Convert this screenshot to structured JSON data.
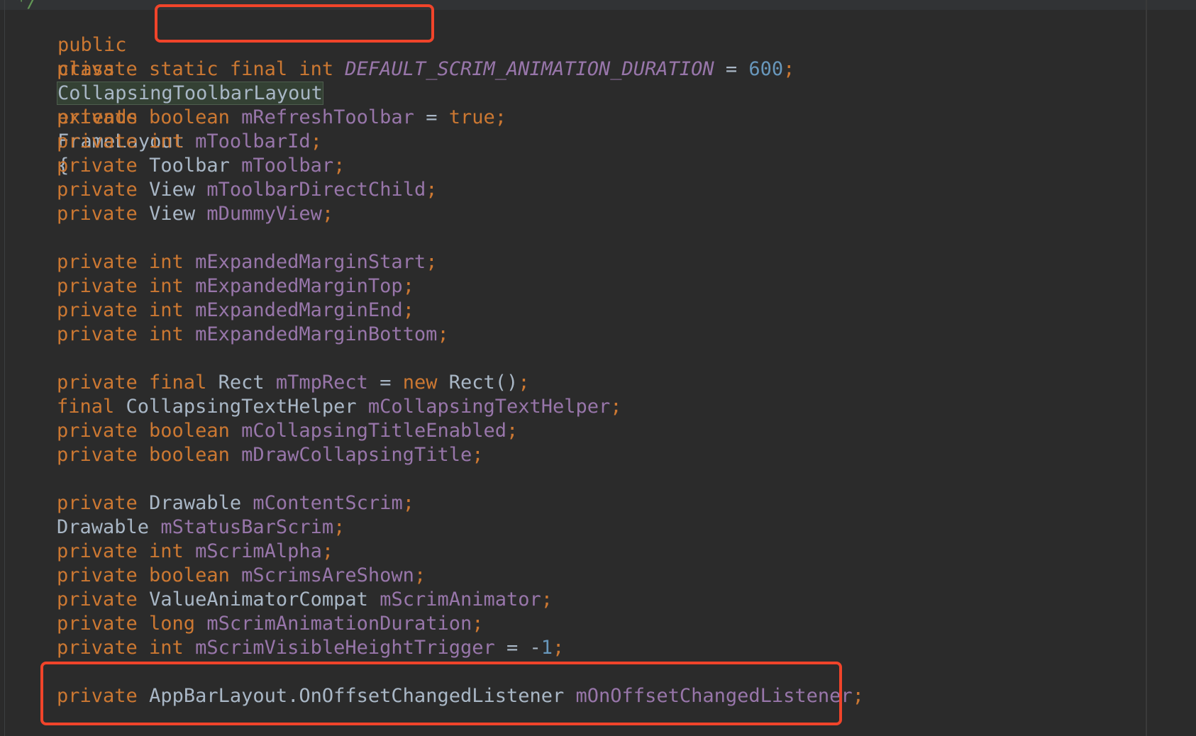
{
  "editor": {
    "comment_tail": "*/",
    "class_decl": {
      "kw_public": "public",
      "kw_class": "class",
      "class_name": "CollapsingToolbarLayout",
      "kw_extends": "extends",
      "super_class": "FrameLayout",
      "open_brace": "{"
    },
    "line_duration": {
      "modifiers": "private static final int",
      "name": "DEFAULT_SCRIM_ANIMATION_DURATION",
      "eq": " = ",
      "value": "600",
      "semi": ";"
    },
    "fields": {
      "refresh": {
        "kw": "private boolean",
        "name": "mRefreshToolbar",
        "eq": " = ",
        "val": "true",
        "semi": ";"
      },
      "toolbarId": {
        "kw": "private int",
        "name": "mToolbarId",
        "semi": ";"
      },
      "toolbar": {
        "kw": "private",
        "type": "Toolbar",
        "name": "mToolbar",
        "semi": ";"
      },
      "directChild": {
        "kw": "private",
        "type": "View",
        "name": "mToolbarDirectChild",
        "semi": ";"
      },
      "dummy": {
        "kw": "private",
        "type": "View",
        "name": "mDummyView",
        "semi": ";"
      },
      "marginStart": {
        "kw": "private int",
        "name": "mExpandedMarginStart",
        "semi": ";"
      },
      "marginTop": {
        "kw": "private int",
        "name": "mExpandedMarginTop",
        "semi": ";"
      },
      "marginEnd": {
        "kw": "private int",
        "name": "mExpandedMarginEnd",
        "semi": ";"
      },
      "marginBottom": {
        "kw": "private int",
        "name": "mExpandedMarginBottom",
        "semi": ";"
      },
      "tmpRect": {
        "kw": "private final",
        "type": "Rect",
        "name": "mTmpRect",
        "eq": " = ",
        "kw_new": "new",
        "ctor": "Rect()",
        "semi": ";"
      },
      "textHelper": {
        "kw": "final",
        "type": "CollapsingTextHelper",
        "name": "mCollapsingTextHelper",
        "semi": ";"
      },
      "titleEnabled": {
        "kw": "private boolean",
        "name": "mCollapsingTitleEnabled",
        "semi": ";"
      },
      "drawTitle": {
        "kw": "private boolean",
        "name": "mDrawCollapsingTitle",
        "semi": ";"
      },
      "contentScrim": {
        "kw": "private",
        "type": "Drawable",
        "name": "mContentScrim",
        "semi": ";"
      },
      "statusBarScrim": {
        "type": "Drawable",
        "name": "mStatusBarScrim",
        "semi": ";"
      },
      "scrimAlpha": {
        "kw": "private int",
        "name": "mScrimAlpha",
        "semi": ";"
      },
      "scrimsShown": {
        "kw": "private boolean",
        "name": "mScrimsAreShown",
        "semi": ";"
      },
      "scrimAnimator": {
        "kw": "private",
        "type": "ValueAnimatorCompat",
        "name": "mScrimAnimator",
        "semi": ";"
      },
      "animDuration": {
        "kw": "private long",
        "name": "mScrimAnimationDuration",
        "semi": ";"
      },
      "heightTrigger": {
        "kw": "private int",
        "name": "mScrimVisibleHeightTrigger",
        "eq": " = ",
        "minus": "-",
        "val": "1",
        "semi": ";"
      },
      "offsetListener": {
        "kw": "private",
        "type": "AppBarLayout.OnOffsetChangedListener",
        "name": "mOnOffsetChangedListener",
        "semi": ";"
      }
    }
  },
  "annotation_color": "#f0442a",
  "syntax_colors": {
    "keyword": "#cc7832",
    "field": "#9876aa",
    "number": "#6897bb",
    "text": "#a9b7c6",
    "background": "#2b2b2b"
  }
}
